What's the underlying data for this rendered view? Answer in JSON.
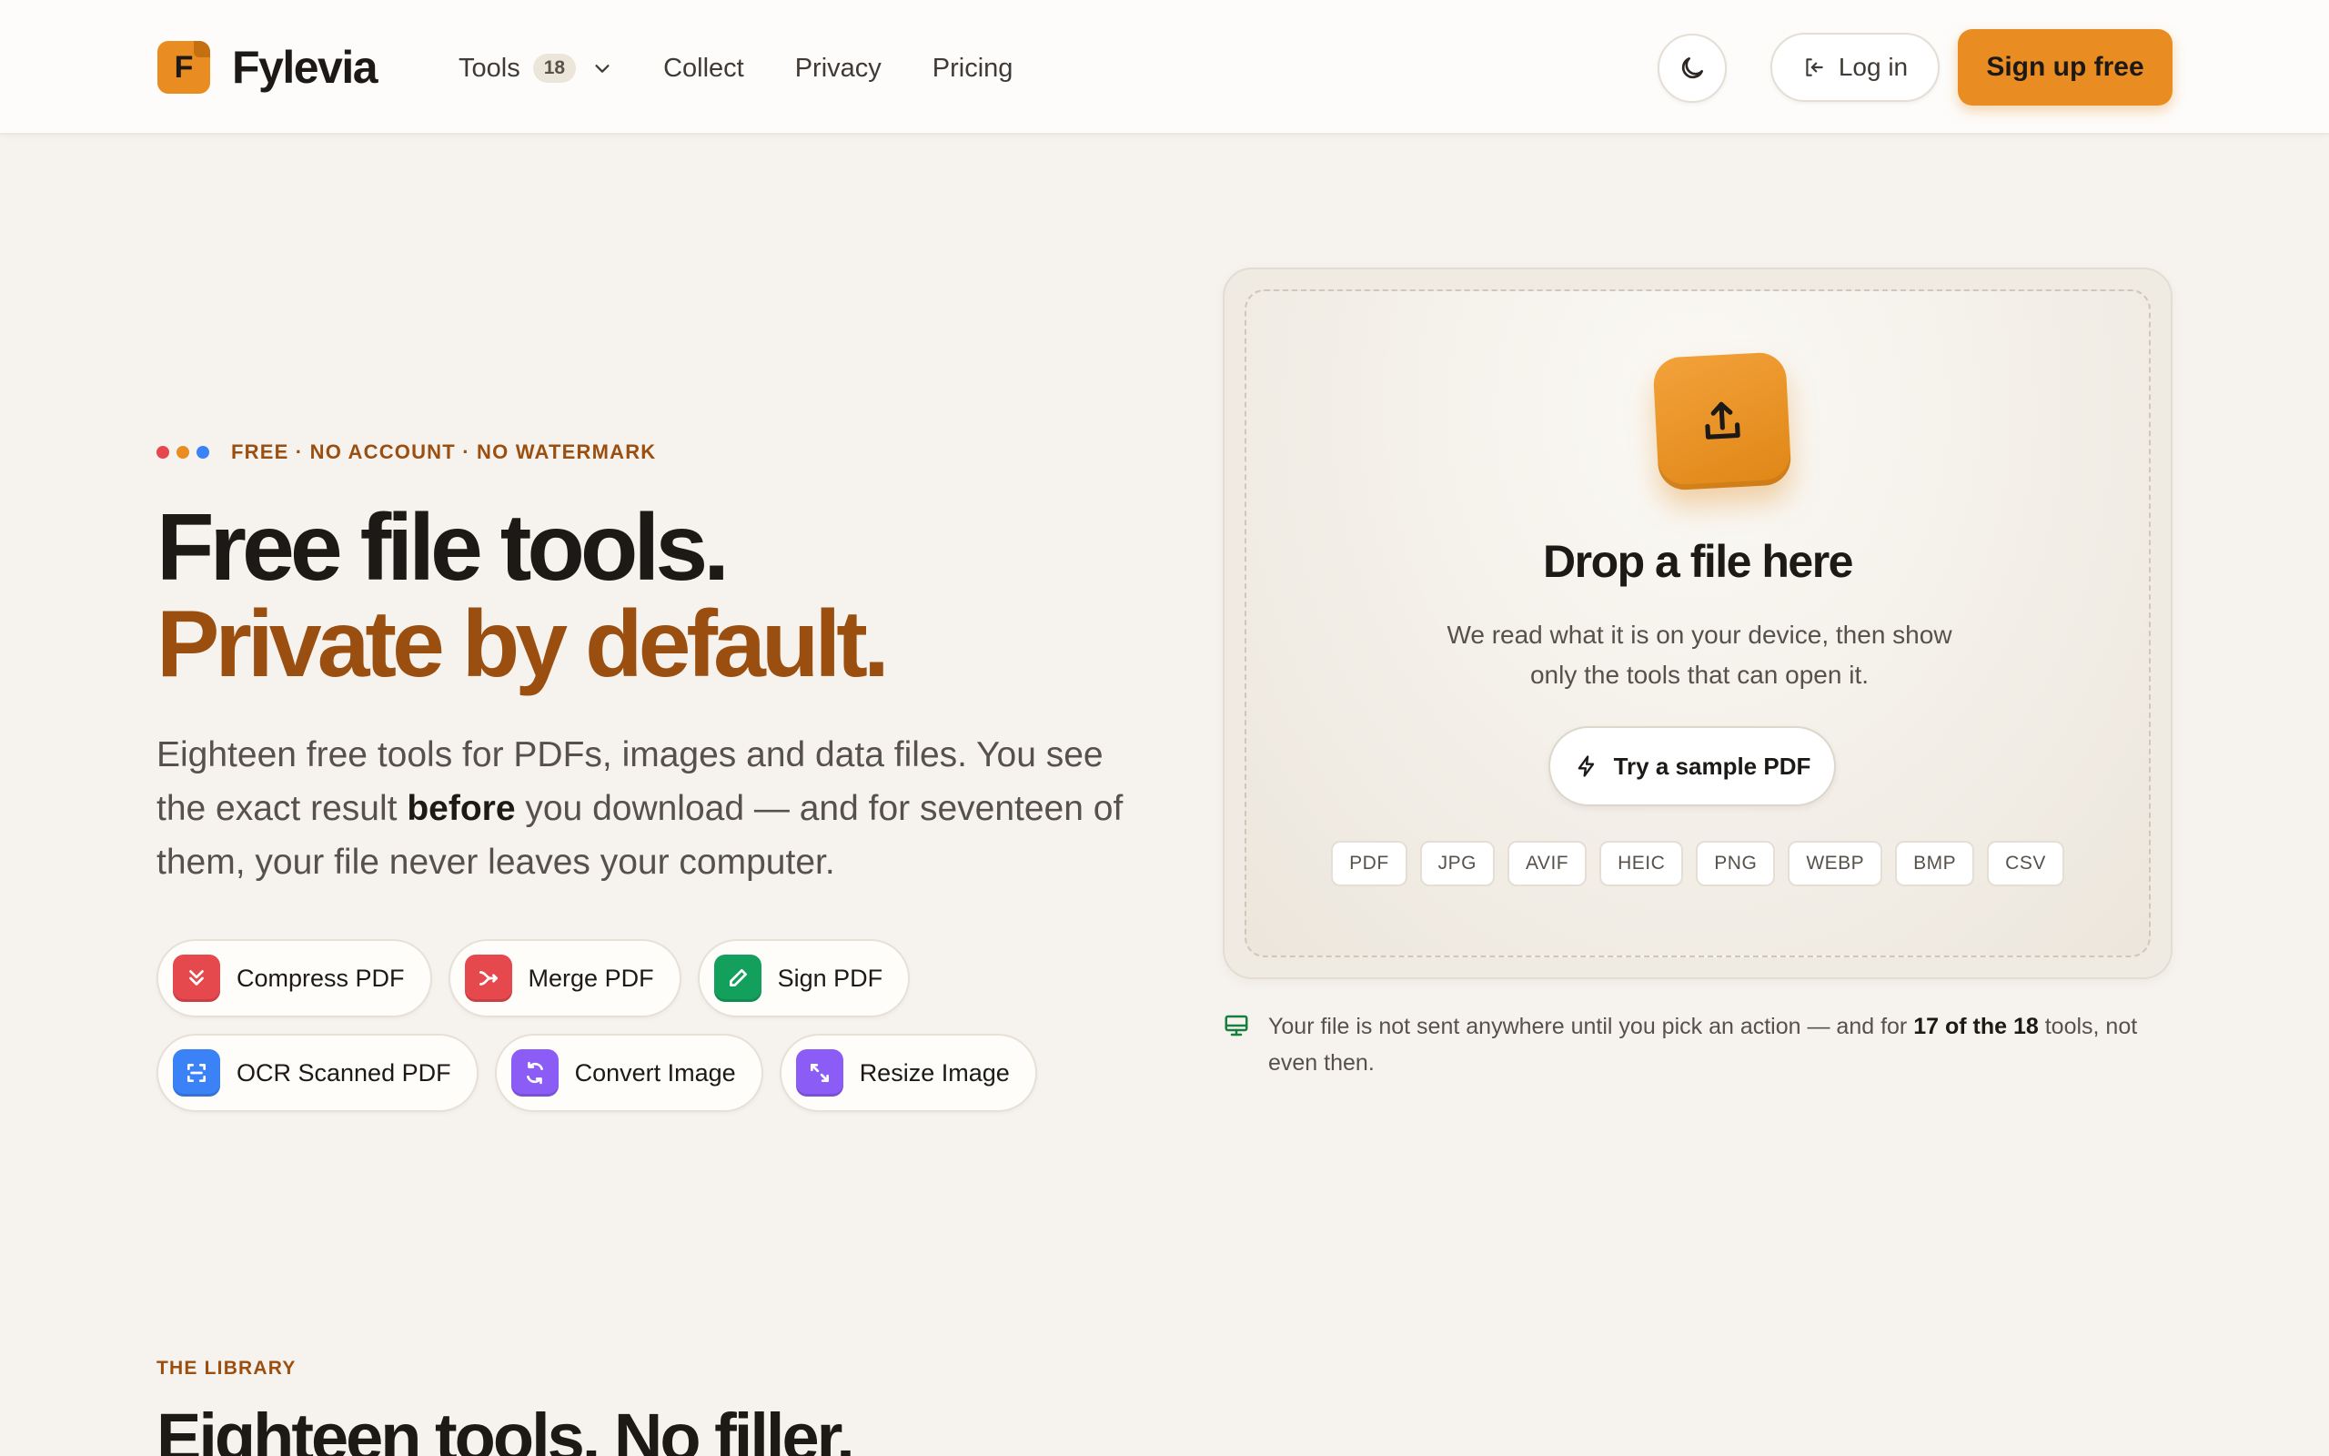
{
  "brand": {
    "name": "Fylevia",
    "logo_letter": "F",
    "accent": "#e98d22",
    "accent_dark": "#9a4f10"
  },
  "nav": {
    "tools_label": "Tools",
    "tools_count": "18",
    "items": [
      "Collect",
      "Privacy",
      "Pricing"
    ]
  },
  "header": {
    "theme_toggle_icon": "moon-icon",
    "login_label": "Log in",
    "signup_label": "Sign up free"
  },
  "hero": {
    "eyebrow": "FREE · NO ACCOUNT · NO WATERMARK",
    "eyebrow_dots": [
      "#e5484d",
      "#e98d22",
      "#3b82f6"
    ],
    "title_line1": "Free file tools.",
    "title_line2": "Private by default.",
    "lede_part1": "Eighteen free tools for PDFs, images and data files. You see the exact result ",
    "lede_bold": "before",
    "lede_part2": " you download — and for seventeen of them, your file never leaves your computer."
  },
  "chips": [
    {
      "label": "Compress PDF",
      "icon": "chevrons-down-icon",
      "color": "#e5484d"
    },
    {
      "label": "Merge PDF",
      "icon": "merge-arrow-icon",
      "color": "#e5484d"
    },
    {
      "label": "Sign PDF",
      "icon": "pen-icon",
      "color": "#12a05c"
    },
    {
      "label": "OCR Scanned PDF",
      "icon": "scan-icon",
      "color": "#3b82f6"
    },
    {
      "label": "Convert Image",
      "icon": "refresh-icon",
      "color": "#8b5cf6"
    },
    {
      "label": "Resize Image",
      "icon": "expand-icon",
      "color": "#8b5cf6"
    }
  ],
  "dropzone": {
    "icon": "upload-icon",
    "title": "Drop a file here",
    "subtitle": "We read what it is on your device, then show only the tools that can open it.",
    "sample_label": "Try a sample PDF",
    "sample_icon": "lightning-icon",
    "formats": [
      "PDF",
      "JPG",
      "AVIF",
      "HEIC",
      "PNG",
      "WEBP",
      "BMP",
      "CSV"
    ]
  },
  "note": {
    "icon": "monitor-icon",
    "text_part1": "Your file is not sent anywhere until you pick an action — and for ",
    "text_bold": "17 of the 18",
    "text_part2": " tools, not even then."
  },
  "library": {
    "eyebrow": "THE LIBRARY",
    "title": "Eighteen tools. No filler."
  }
}
